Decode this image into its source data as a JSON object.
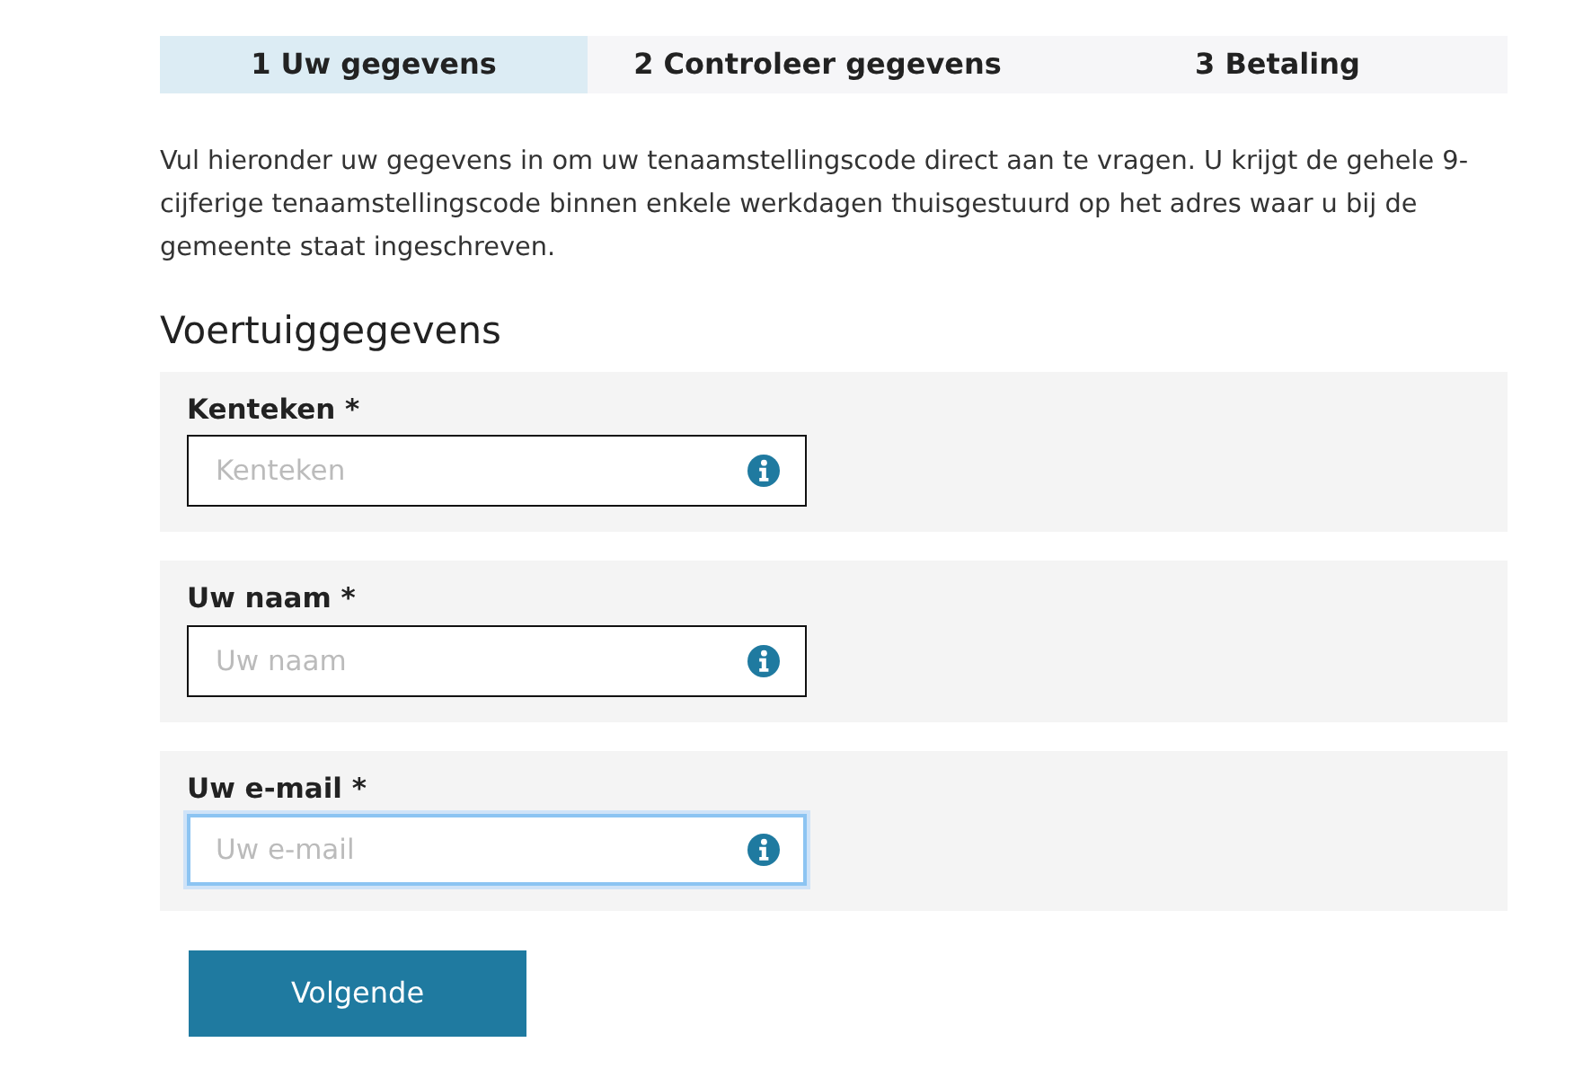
{
  "steps": [
    {
      "label": "1 Uw gegevens",
      "selected": true
    },
    {
      "label": "2 Controleer gegevens",
      "selected": false
    },
    {
      "label": "3 Betaling",
      "selected": false
    }
  ],
  "intro": "Vul hieronder uw gegevens in om uw tenaamstellingscode direct aan te vragen. U krijgt de gehele 9-cijferige tenaamstellingscode binnen enkele werkdagen thuisgestuurd op het adres waar u bij de gemeente staat ingeschreven.",
  "section_title": "Voertuiggegevens",
  "fields": [
    {
      "label": "Kenteken *",
      "placeholder": "Kenteken",
      "focused": false
    },
    {
      "label": "Uw naam *",
      "placeholder": "Uw naam",
      "focused": false
    },
    {
      "label": "Uw e-mail *",
      "placeholder": "Uw e-mail",
      "focused": true
    }
  ],
  "buttons": [
    "Volgende"
  ]
}
